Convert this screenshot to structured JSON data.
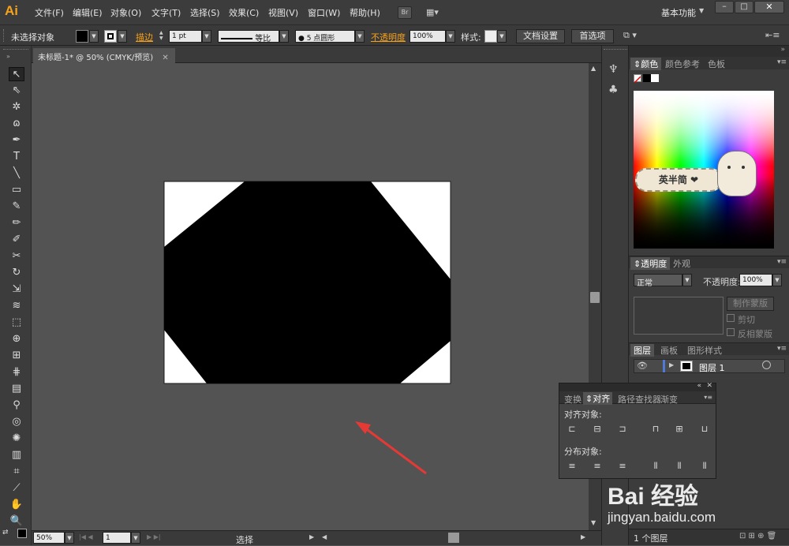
{
  "app": {
    "logo": "Ai",
    "workspace": "基本功能"
  },
  "menu": [
    "文件(F)",
    "编辑(E)",
    "对象(O)",
    "文字(T)",
    "选择(S)",
    "效果(C)",
    "视图(V)",
    "窗口(W)",
    "帮助(H)"
  ],
  "menu_extra": {
    "bridge": "Br"
  },
  "control": {
    "selection_label": "未选择对象",
    "stroke_label": "描边",
    "stroke_value": "1 pt",
    "stroke_profile": "等比",
    "brush": "5 点圆形",
    "opacity_label": "不透明度",
    "opacity_value": "100%",
    "style_label": "样式:",
    "doc_setup": "文档设置",
    "prefs": "首选项"
  },
  "document": {
    "tab_title": "未标题-1* @ 50% (CMYK/预览)"
  },
  "status": {
    "zoom": "50%",
    "page": "1",
    "tool": "选择"
  },
  "color_panel": {
    "tabs": [
      "颜色",
      "颜色参考",
      "色板"
    ]
  },
  "transparency_panel": {
    "tabs": [
      "透明度",
      "外观"
    ],
    "blend_mode": "正常",
    "opacity_label": "不透明度:",
    "opacity_value": "100%",
    "make_mask": "制作蒙版",
    "clip": "剪切",
    "invert_mask": "反相蒙版"
  },
  "layers_panel": {
    "tabs": [
      "图层",
      "画板",
      "图形样式"
    ],
    "layer_name": "图层 1",
    "footer_count": "1 个图层"
  },
  "align_panel": {
    "tabs": [
      "变换",
      "对齐",
      "路径查找器",
      "渐变"
    ],
    "align_objects_label": "对齐对象:",
    "distribute_objects_label": "分布对象:"
  },
  "sticker": {
    "text": "英半简 ❤"
  },
  "watermark": {
    "brand": "Bai 经验",
    "url": "jingyan.baidu.com"
  },
  "colors": {
    "accent_orange": "#f7a21b",
    "red_arrow": "#e53935",
    "canvas_bg": "#535353",
    "artwork": "#000000"
  }
}
